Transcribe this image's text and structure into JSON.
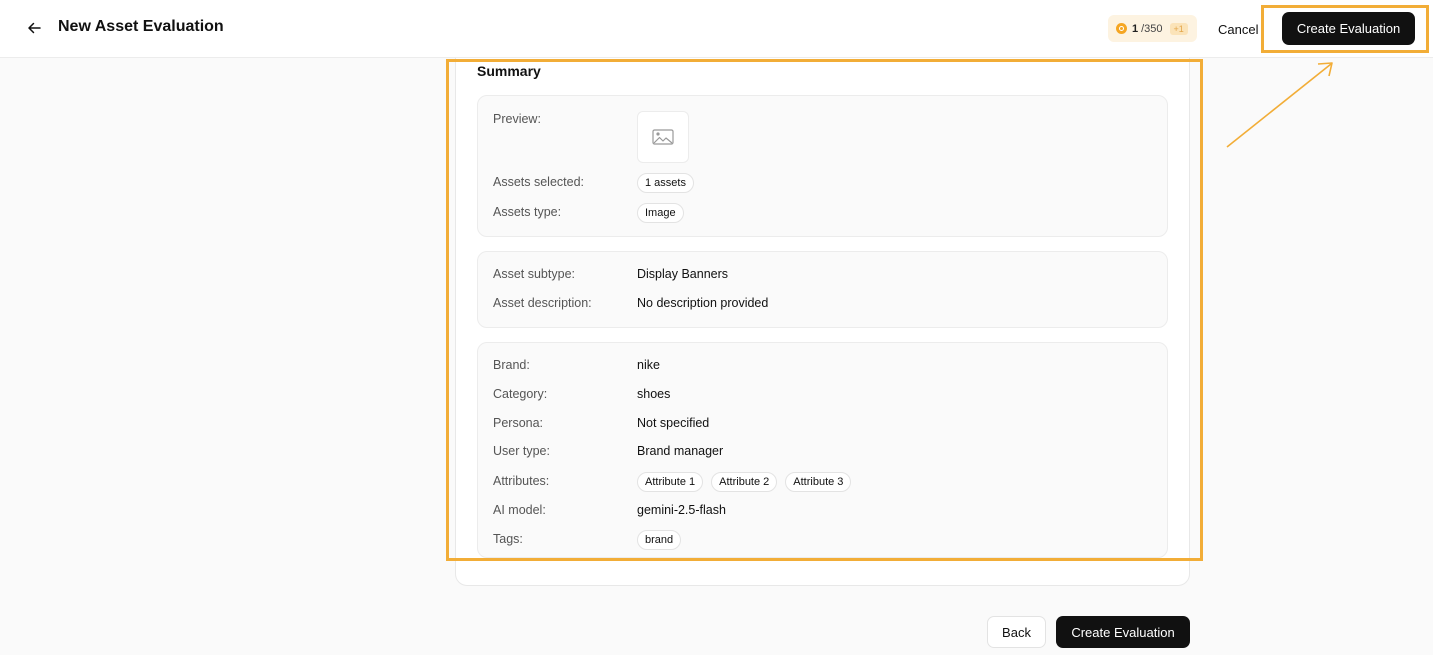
{
  "header": {
    "title": "New Asset Evaluation",
    "credits": {
      "used": "1",
      "total": "/350",
      "plus": "+1"
    },
    "cancel_label": "Cancel",
    "create_label": "Create Evaluation"
  },
  "summary": {
    "title": "Summary",
    "preview_label": "Preview:",
    "assets_selected_label": "Assets selected:",
    "assets_selected_value": "1 assets",
    "assets_type_label": "Assets type:",
    "assets_type_value": "Image",
    "asset_subtype_label": "Asset subtype:",
    "asset_subtype_value": "Display Banners",
    "asset_description_label": "Asset description:",
    "asset_description_value": "No description provided",
    "brand_label": "Brand:",
    "brand_value": "nike",
    "category_label": "Category:",
    "category_value": "shoes",
    "persona_label": "Persona:",
    "persona_value": "Not specified",
    "user_type_label": "User type:",
    "user_type_value": "Brand manager",
    "attributes_label": "Attributes:",
    "attributes": [
      "Attribute 1",
      "Attribute 2",
      "Attribute 3"
    ],
    "ai_model_label": "AI model:",
    "ai_model_value": "gemini-2.5-flash",
    "tags_label": "Tags:",
    "tags": [
      "brand"
    ]
  },
  "footer": {
    "back_label": "Back",
    "create_label": "Create Evaluation"
  },
  "colors": {
    "accent_highlight": "#f2ad37",
    "primary_button": "#111111",
    "coin": "#f5a623"
  },
  "icons": [
    "back-arrow-icon",
    "coin-icon",
    "image-placeholder-icon"
  ]
}
